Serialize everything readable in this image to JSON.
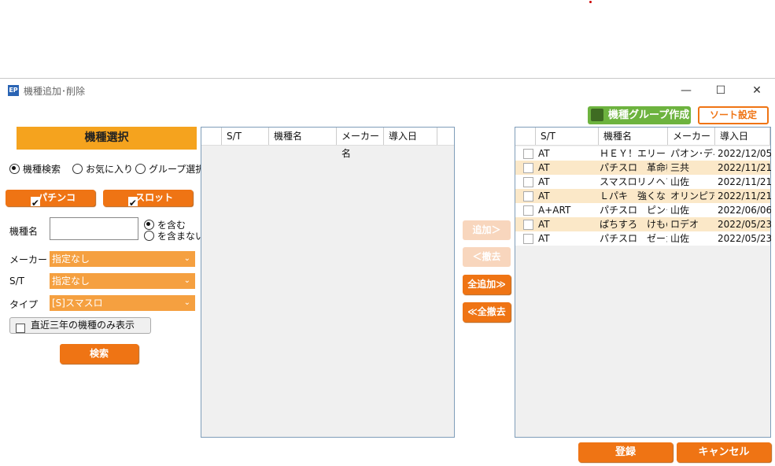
{
  "window": {
    "title": "機種追加･削除",
    "icon_text": "EP",
    "min": "—",
    "max": "☐",
    "close": "✕"
  },
  "toolbar": {
    "group_create": "機種グループ作成",
    "sort_setting": "ソート設定"
  },
  "left": {
    "header": "機種選択",
    "search_modes": [
      "機種検索",
      "お気に入り",
      "グループ選択"
    ],
    "pachinko": "パチンコ",
    "slot": "スロット",
    "name_label": "機種名",
    "name_value": "",
    "include": "を含む",
    "exclude": "を含まない",
    "maker_label": "メーカー",
    "maker_value": "指定なし",
    "st_label": "S/T",
    "st_value": "指定なし",
    "type_label": "タイプ",
    "type_value": "[S]スマスロ",
    "recent_only": "直近三年の機種のみ表示",
    "search_button": "検索"
  },
  "columns": {
    "st": "S/T",
    "name": "機種名",
    "maker": "メーカー名",
    "date": "導入日"
  },
  "mid": {
    "add": "追加＞",
    "remove": "＜撤去",
    "add_all": "全追加≫",
    "remove_all": "≪全撤去"
  },
  "right_rows": [
    {
      "st": "AT",
      "name": "ＨＥＹ！エリート",
      "maker": "パオン･ディー",
      "date": "2022/12/05"
    },
    {
      "st": "AT",
      "name": "パチスロ　革命機",
      "maker": "三共",
      "date": "2022/11/21"
    },
    {
      "st": "AT",
      "name": "スマスロリノヘブン",
      "maker": "山佐",
      "date": "2022/11/21"
    },
    {
      "st": "AT",
      "name": "Ｌパキ　強くなりた",
      "maker": "オリンピア",
      "date": "2022/11/21"
    },
    {
      "st": "A+ART",
      "name": "パチスロ　ピンクパ",
      "maker": "山佐",
      "date": "2022/06/06"
    },
    {
      "st": "AT",
      "name": "ぱちすろ　けものフ",
      "maker": "ロデオ",
      "date": "2022/05/23"
    },
    {
      "st": "AT",
      "name": "パチスロ　ゼーガペ",
      "maker": "山佐",
      "date": "2022/05/23"
    }
  ],
  "footer": {
    "register": "登録",
    "cancel": "キャンセル"
  },
  "colors": {
    "accent": "#ef7414",
    "header": "#f5a31e",
    "row_alt": "#fbe8c8"
  }
}
